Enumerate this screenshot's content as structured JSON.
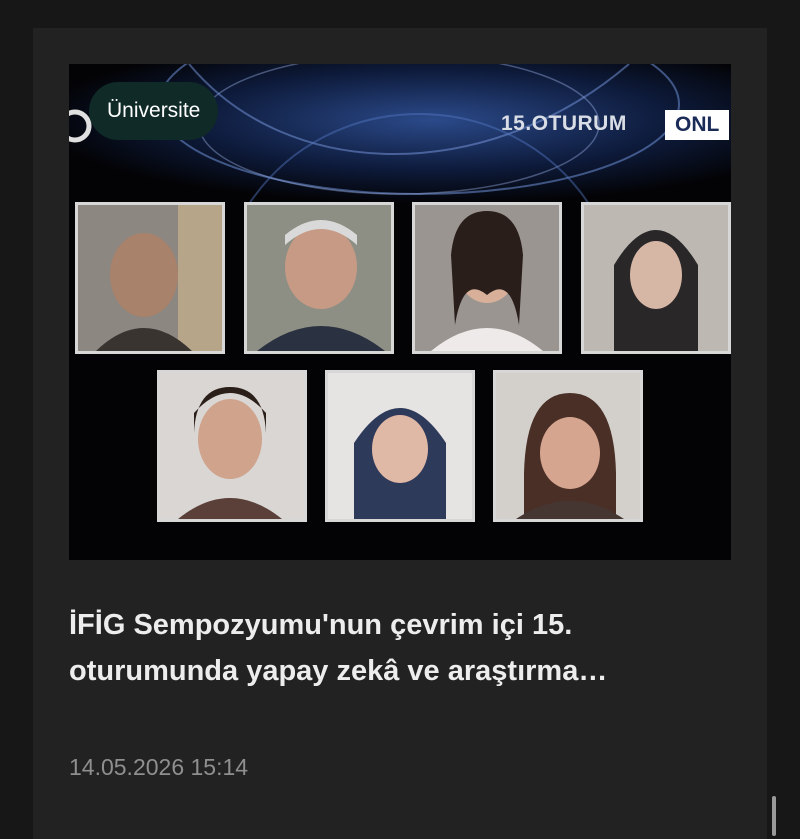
{
  "article": {
    "category": "Üniversite",
    "session_label": "15.OTURUM",
    "session_tag": "ONL",
    "title_line1": "İFİG Sempozyumu'nun çevrim içi 15.",
    "title_line2": "oturumunda yapay zekâ ve araştırma…",
    "date": "14.05.2026 15:14"
  },
  "colors": {
    "badge_bg": "#0f2a27",
    "card_bg": "#222222",
    "page_bg": "#171717"
  }
}
